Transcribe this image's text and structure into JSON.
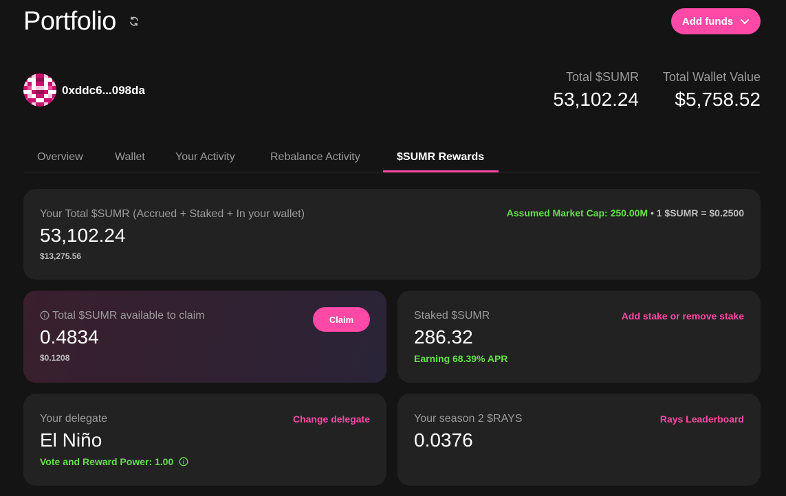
{
  "header": {
    "title": "Portfolio",
    "add_funds_label": "Add funds"
  },
  "account": {
    "address": "0xddc6...098da"
  },
  "stats": {
    "total_sumr_label": "Total $SUMR",
    "total_sumr_value": "53,102.24",
    "wallet_value_label": "Total Wallet Value",
    "wallet_value": "$5,758.52"
  },
  "tabs": [
    {
      "label": "Overview",
      "active": false
    },
    {
      "label": "Wallet",
      "active": false
    },
    {
      "label": "Your Activity",
      "active": false
    },
    {
      "label": "Rebalance Activity",
      "active": false
    },
    {
      "label": "$SUMR Rewards",
      "active": true
    }
  ],
  "total_card": {
    "label": "Your Total $SUMR (Accrued + Staked + In your wallet)",
    "value": "53,102.24",
    "usd": "$13,275.56",
    "market_cap": "Assumed Market Cap: 250.00M",
    "price_sep": "•",
    "price": "1 $SUMR = $0.2500"
  },
  "claim_card": {
    "label": "Total $SUMR available to claim",
    "value": "0.4834",
    "usd": "$0.1208",
    "button_label": "Claim"
  },
  "staked_card": {
    "label": "Staked $SUMR",
    "value": "286.32",
    "apr": "Earning 68.39% APR",
    "link": "Add stake or remove stake"
  },
  "delegate_card": {
    "label": "Your delegate",
    "value": "El Niño",
    "power": "Vote and Reward Power: 1.00",
    "link": "Change delegate"
  },
  "rays_card": {
    "label": "Your season 2 $RAYS",
    "value": "0.0376",
    "link": "Rays Leaderboard"
  },
  "colors": {
    "accent": "#ff49a6",
    "positive": "#64e04b",
    "background": "#141414",
    "card": "#222222"
  },
  "icons": [
    "refresh-icon",
    "chevron-down-icon",
    "info-icon",
    "avatar-identicon"
  ]
}
